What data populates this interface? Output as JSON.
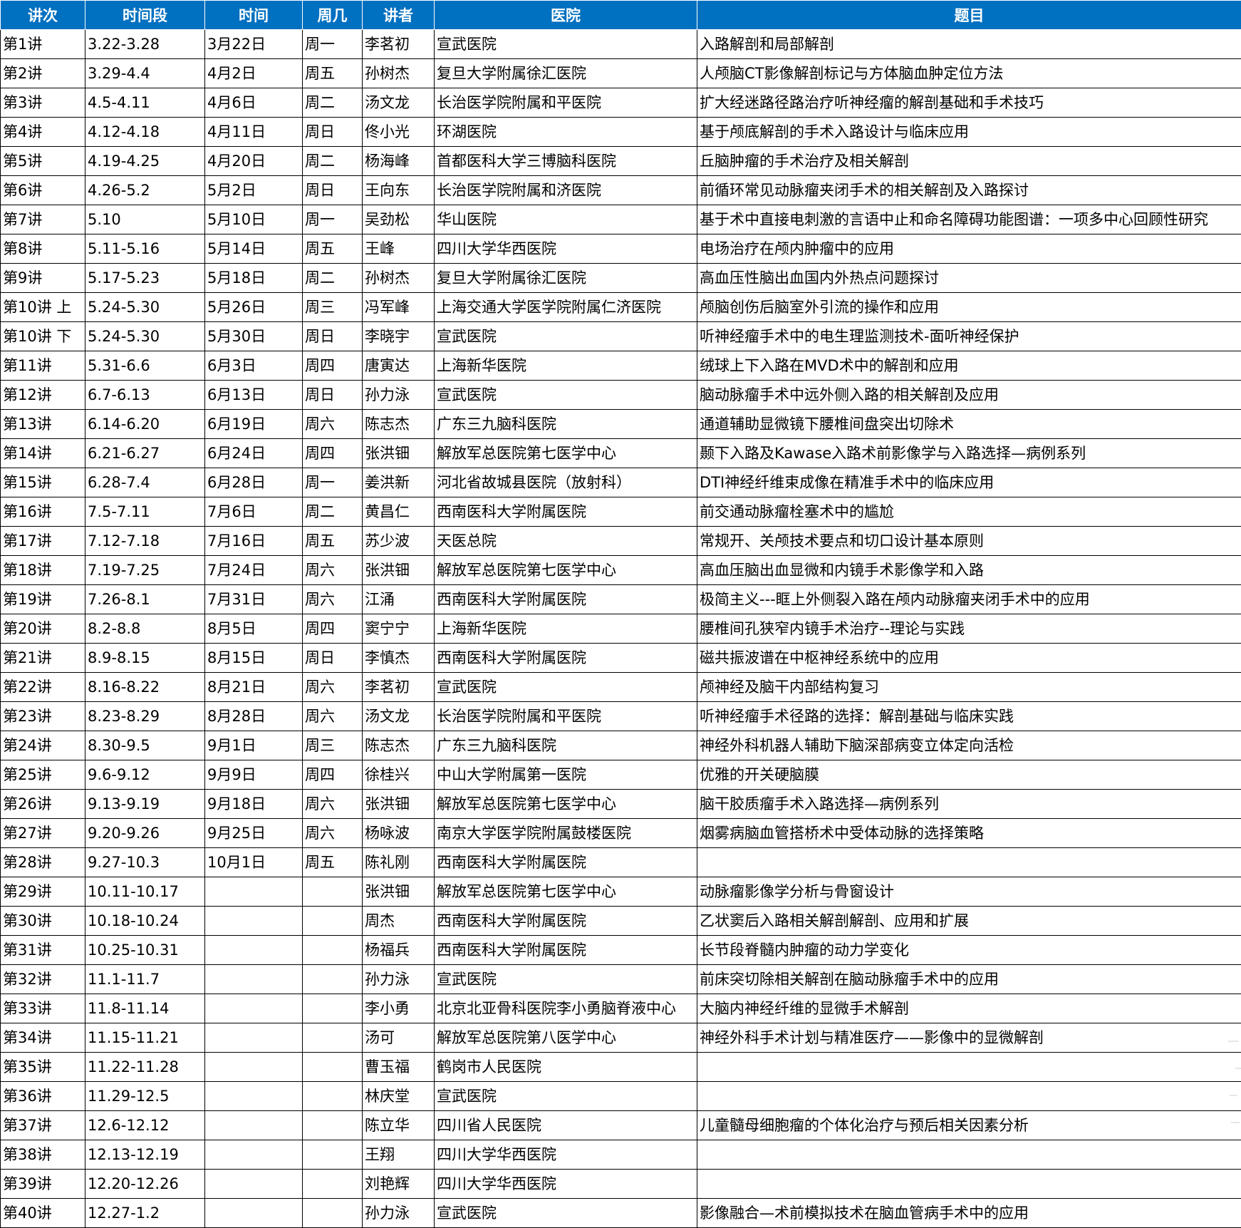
{
  "columns": [
    "讲次",
    "时间段",
    "时间",
    "周几",
    "讲者",
    "医院",
    "题目"
  ],
  "rows": [
    [
      "第1讲",
      "3.22-3.28",
      "3月22日",
      "周一",
      "李茗初",
      "宣武医院",
      "入路解剖和局部解剖"
    ],
    [
      "第2讲",
      "3.29-4.4",
      "4月2日",
      "周五",
      "孙树杰",
      "复旦大学附属徐汇医院",
      "人颅脑CT影像解剖标记与方体脑血肿定位方法"
    ],
    [
      "第3讲",
      "4.5-4.11",
      "4月6日",
      "周二",
      "汤文龙",
      "长治医学院附属和平医院",
      "扩大经迷路径路治疗听神经瘤的解剖基础和手术技巧"
    ],
    [
      "第4讲",
      "4.12-4.18",
      "4月11日",
      "周日",
      "佟小光",
      "环湖医院",
      "基于颅底解剖的手术入路设计与临床应用"
    ],
    [
      "第5讲",
      "4.19-4.25",
      "4月20日",
      "周二",
      "杨海峰",
      "首都医科大学三博脑科医院",
      "丘脑肿瘤的手术治疗及相关解剖"
    ],
    [
      "第6讲",
      "4.26-5.2",
      "5月2日",
      "周日",
      "王向东",
      "长治医学院附属和济医院",
      "前循环常见动脉瘤夹闭手术的相关解剖及入路探讨"
    ],
    [
      "第7讲",
      "5.10",
      "5月10日",
      "周一",
      "吴劲松",
      "华山医院",
      "基于术中直接电刺激的言语中止和命名障碍功能图谱：一项多中心回顾性研究"
    ],
    [
      "第8讲",
      "5.11-5.16",
      "5月14日",
      "周五",
      "王峰",
      "四川大学华西医院",
      "电场治疗在颅内肿瘤中的应用"
    ],
    [
      "第9讲",
      "5.17-5.23",
      "5月18日",
      "周二",
      "孙树杰",
      "复旦大学附属徐汇医院",
      "高血压性脑出血国内外热点问题探讨"
    ],
    [
      "第10讲 上",
      "5.24-5.30",
      "5月26日",
      "周三",
      "冯军峰",
      "上海交通大学医学院附属仁济医院",
      "颅脑创伤后脑室外引流的操作和应用"
    ],
    [
      "第10讲 下",
      "5.24-5.30",
      "5月30日",
      "周日",
      "李晓宇",
      "宣武医院",
      "听神经瘤手术中的电生理监测技术-面听神经保护"
    ],
    [
      "第11讲",
      "5.31-6.6",
      "6月3日",
      "周四",
      "唐寅达",
      "上海新华医院",
      "绒球上下入路在MVD术中的解剖和应用"
    ],
    [
      "第12讲",
      "6.7-6.13",
      "6月13日",
      "周日",
      "孙力泳",
      "宣武医院",
      "脑动脉瘤手术中远外侧入路的相关解剖及应用"
    ],
    [
      "第13讲",
      "6.14-6.20",
      "6月19日",
      "周六",
      "陈志杰",
      "广东三九脑科医院",
      "通道辅助显微镜下腰椎间盘突出切除术"
    ],
    [
      "第14讲",
      "6.21-6.27",
      "6月24日",
      "周四",
      "张洪钿",
      "解放军总医院第七医学中心",
      "颞下入路及Kawase入路术前影像学与入路选择—病例系列"
    ],
    [
      "第15讲",
      "6.28-7.4",
      "6月28日",
      "周一",
      "姜洪新",
      "河北省故城县医院（放射科）",
      "DTI神经纤维束成像在精准手术中的临床应用"
    ],
    [
      "第16讲",
      "7.5-7.11",
      "7月6日",
      "周二",
      "黄昌仁",
      "西南医科大学附属医院",
      "前交通动脉瘤栓塞术中的尴尬"
    ],
    [
      "第17讲",
      "7.12-7.18",
      "7月16日",
      "周五",
      "苏少波",
      "天医总院",
      "常规开、关颅技术要点和切口设计基本原则"
    ],
    [
      "第18讲",
      "7.19-7.25",
      "7月24日",
      "周六",
      "张洪钿",
      "解放军总医院第七医学中心",
      "高血压脑出血显微和内镜手术影像学和入路"
    ],
    [
      "第19讲",
      "7.26-8.1",
      "7月31日",
      "周六",
      "江涌",
      "西南医科大学附属医院",
      "极简主义---眶上外侧裂入路在颅内动脉瘤夹闭手术中的应用"
    ],
    [
      "第20讲",
      "8.2-8.8",
      "8月5日",
      "周四",
      "窦宁宁",
      "上海新华医院",
      "腰椎间孔狭窄内镜手术治疗--理论与实践"
    ],
    [
      "第21讲",
      "8.9-8.15",
      "8月15日",
      "周日",
      "李慎杰",
      "西南医科大学附属医院",
      "磁共振波谱在中枢神经系统中的应用"
    ],
    [
      "第22讲",
      "8.16-8.22",
      "8月21日",
      "周六",
      "李茗初",
      "宣武医院",
      "颅神经及脑干内部结构复习"
    ],
    [
      "第23讲",
      "8.23-8.29",
      "8月28日",
      "周六",
      "汤文龙",
      "长治医学院附属和平医院",
      "听神经瘤手术径路的选择：解剖基础与临床实践"
    ],
    [
      "第24讲",
      "8.30-9.5",
      "9月1日",
      "周三",
      "陈志杰",
      "广东三九脑科医院",
      "神经外科机器人辅助下脑深部病变立体定向活检"
    ],
    [
      "第25讲",
      "9.6-9.12",
      "9月9日",
      "周四",
      "徐桂兴",
      "中山大学附属第一医院",
      "优雅的开关硬脑膜"
    ],
    [
      "第26讲",
      "9.13-9.19",
      "9月18日",
      "周六",
      "张洪钿",
      "解放军总医院第七医学中心",
      "脑干胶质瘤手术入路选择—病例系列"
    ],
    [
      "第27讲",
      "9.20-9.26",
      "9月25日",
      "周六",
      "杨咏波",
      "南京大学医学院附属鼓楼医院",
      "烟雾病脑血管搭桥术中受体动脉的选择策略"
    ],
    [
      "第28讲",
      "9.27-10.3",
      "10月1日",
      "周五",
      "陈礼刚",
      "西南医科大学附属医院",
      ""
    ],
    [
      "第29讲",
      "10.11-10.17",
      "",
      "",
      "张洪钿",
      "解放军总医院第七医学中心",
      "动脉瘤影像学分析与骨窗设计"
    ],
    [
      "第30讲",
      "10.18-10.24",
      "",
      "",
      "周杰",
      "西南医科大学附属医院",
      "乙状窦后入路相关解剖解剖、应用和扩展"
    ],
    [
      "第31讲",
      "10.25-10.31",
      "",
      "",
      "杨福兵",
      "西南医科大学附属医院",
      "长节段脊髓内肿瘤的动力学变化"
    ],
    [
      "第32讲",
      "11.1-11.7",
      "",
      "",
      "孙力泳",
      "宣武医院",
      "前床突切除相关解剖在脑动脉瘤手术中的应用"
    ],
    [
      "第33讲",
      "11.8-11.14",
      "",
      "",
      "李小勇",
      "北京北亚骨科医院李小勇脑脊液中心",
      "大脑内神经纤维的显微手术解剖"
    ],
    [
      "第34讲",
      "11.15-11.21",
      "",
      "",
      "汤可",
      "解放军总医院第八医学中心",
      "神经外科手术计划与精准医疗——影像中的显微解剖"
    ],
    [
      "第35讲",
      "11.22-11.28",
      "",
      "",
      "曹玉福",
      "鹤岗市人民医院",
      ""
    ],
    [
      "第36讲",
      "11.29-12.5",
      "",
      "",
      "林庆堂",
      "宣武医院",
      ""
    ],
    [
      "第37讲",
      "12.6-12.12",
      "",
      "",
      "陈立华",
      "四川省人民医院",
      "儿童髓母细胞瘤的个体化治疗与预后相关因素分析"
    ],
    [
      "第38讲",
      "12.13-12.19",
      "",
      "",
      "王翔",
      "四川大学华西医院",
      ""
    ],
    [
      "第39讲",
      "12.20-12.26",
      "",
      "",
      "刘艳辉",
      "四川大学华西医院",
      ""
    ],
    [
      "第40讲",
      "12.27-1.2",
      "",
      "",
      "孙力泳",
      "宣武医院",
      "影像融合—术前模拟技术在脑血管病手术中的应用"
    ]
  ],
  "colors": {
    "header_bg": "#0070c0",
    "header_text": "#ffffff",
    "grid": "#000000"
  }
}
